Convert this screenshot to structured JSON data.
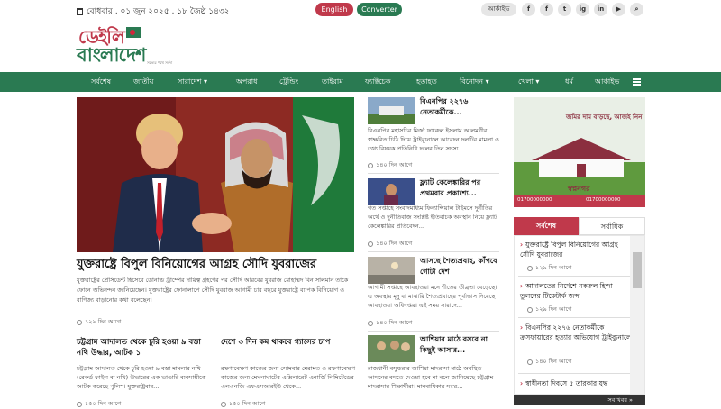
{
  "topbar": {
    "date": "বোধবার , ০১ জুন ২০২৫ , ১৮ জৈষ্ঠ ১৪৩২",
    "english_label": "English",
    "converter_label": "Converter",
    "archive_label": "আর্কাইভ",
    "social": [
      "f",
      "f",
      "t",
      "ig",
      "in",
      "▶",
      "⌕"
    ]
  },
  "logo": {
    "line1": "ডেইলি",
    "line2": "বাংলাদেশ",
    "tagline": "সত্যের পথে সর্বদা"
  },
  "nav": {
    "items": [
      "সর্বশেষ",
      "জাতীয়",
      "সারাদেশ ▾",
      "অপরাধ",
      "ট্রেন্ডিং",
      "তাইরাম",
      "ফ্যাক্টচেক",
      "হতাহত",
      "বিনোদন ▾",
      "খেলা ▾",
      "ধর্ম",
      "আর্কাইভ"
    ]
  },
  "lead": {
    "title": "যুক্তরাষ্ট্রে বিপুল বিনিয়োগের আগ্রহ সৌদি যুবরাজের",
    "text": "যুক্তরাষ্ট্রের প্রেসিডেন্ট হিসেবে ডোনাল্ড ট্রাম্পের দায়িত্ব গ্রহণের পর সৌদি আরবের যুবরাজ মোহাম্মদ বিন সালমান তাকে ফোনে অভিনন্দন জানিয়েছেন। যুক্তরাষ্ট্রের ফোনালাপে সৌদি যুবরাজ আগামী চার বছরে যুক্তরাষ্ট্রে ব্যাপক বিনিয়োগ ও বাণিজ্য বাড়ানোর কথা বলেছেন।",
    "time": "১২৯ দিন আগে"
  },
  "bottom_stories": [
    {
      "title": "চট্টগ্রাম আদালত থেকে চুরি হওয়া ৯ বস্তা নথি উদ্ধার, আটক ১",
      "text": "চট্টগ্রাম আদালত থেকে চুরি হওয়া ৯ বস্তা মামলার নথি (রেকর্ড ফাইল বা নথি) উদ্ধারের এক ভাঙারি ব্যবসায়ীকে আটক করেছে পুলিশ। যুক্তরাষ্ট্রবার...",
      "time": "১৫০ দিন আগে"
    },
    {
      "title": "দেশে ৩ দিন কম থাকবে গ্যাসের চাপ",
      "text": "রক্ষণাবেক্ষণ কাজের জন্য সোমবার মেরামত ও রক্ষণাবেক্ষণ কাজের জন্য মেঘনাঘাটের এক্সিলারেট এনার্জি লিমিটেডের এলএনজি এফএসআরইউ থেকে...",
      "time": "১৫০ দিন আগে"
    }
  ],
  "middle_stories": [
    {
      "title": "বিএনপির ২২৭৬ নেতাকর্মীকে...",
      "text": "বিএনপির মহাসচিব মির্জা ফখরুল ইসলাম আলমগীর স্বাক্ষরিত চিঠি দিয়ে ট্রাইব্যুনালে আবেদন দলটির মামলা ও তথ্য বিষয়ক প্রতিনিধি দলের তিন সদস্য...",
      "time": "১৪০ দিন আগে"
    },
    {
      "title": "ফ্ল্যাট কেলেঙ্কারির পর প্রথমবার প্রকাশ্যে...",
      "text": "গত সপ্তাহে সংবাদমাধ্যম ফিন্যান্সিয়াল টাইমসে দুর্নীতির অর্থে ও দুর্নীতিবাজ সংশ্লিষ্ট ইতিবাচক অবস্থান নিয়ে ফ্ল্যাট কেলেঙ্কারির প্রতিবেদন...",
      "time": "১৪০ দিন আগে"
    },
    {
      "title": "আসছে শৈত্যপ্রবাহ, কাঁপবে গোটা দেশ",
      "text": "আগামী সপ্তাহে আবহাওয়া মনে শীতের তীব্রতা বেড়েছে। এ অবস্থায় মৃদু বা মাঝারি শৈত্যপ্রবাহের পূর্বাভাস দিয়েছে আবহাওয়া অধিদপ্তর। এই সময় সারাদে...",
      "time": "১৪০ দিন আগে"
    },
    {
      "title": "আশিয়ার মাঠে বসবে না কিছুই আসার...",
      "text": "রাজধানী বসুন্ধরার আশিয়া মাদরাসা মাঠে অবস্থিত আসনের বসতে দেওয়া হবে না বলে জানিয়েছে চট্টগ্রাম মাদরাসার শিক্ষার্থীরা। মানবাধিকার সম্মে...",
      "time": ""
    }
  ],
  "ad": {
    "brand": "স্বপ্ননগর",
    "text": "জমির দাম বাড়ছে, আজই নিন",
    "phone1": "01700000000",
    "phone2": "01700000000"
  },
  "sidebar": {
    "tab_latest": "সর্বশেষ",
    "tab_popular": "সর্বাধিক",
    "items": [
      {
        "title": "যুক্তরাষ্ট্রে বিপুল বিনিয়োগের আগ্রহ সৌদি যুবরাজের",
        "time": "১২৯ দিন আগে"
      },
      {
        "title": "আদালতের নির্দেশে নকরুল হিন্দা তুলনের টিকেটার্ক জব্দ",
        "time": "১২৯ দিন আগে"
      },
      {
        "title": "বিএনপির ২২৭৬ নেতাকর্মীকে ক্রসফায়ারের হত্যার অভিযোগ ট্রাইব্যুনালে",
        "time": "১৪০ দিন আগে"
      },
      {
        "title": "স্বাধীনতা দিবসে ৫ তারকার যুদ্ধ",
        "time": ""
      }
    ],
    "more_label": "সব খবর »"
  },
  "colors": {
    "brand_green": "#2a7a52",
    "brand_red": "#c0394b"
  }
}
